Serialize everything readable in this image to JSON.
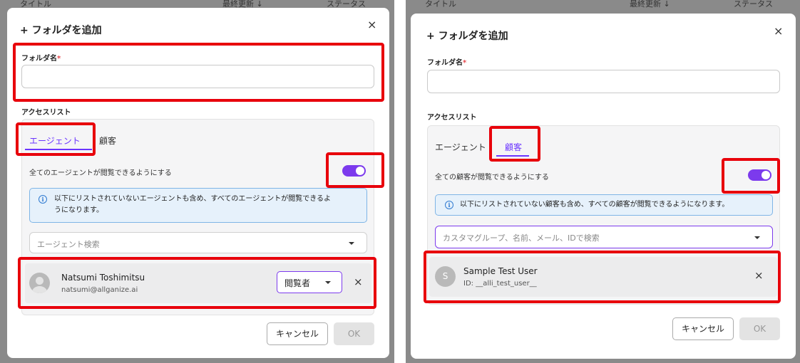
{
  "left": {
    "bg_header": {
      "col_title": "タイトル",
      "col_updated": "最終更新 ↓",
      "col_status": "ステータス"
    },
    "dialog": {
      "title": "+ フォルダを追加",
      "close_icon": "×",
      "folder_label": "フォルダ名",
      "required_mark": "*",
      "folder_value": "",
      "access_list_label": "アクセスリスト",
      "tabs": [
        {
          "label": "エージェント",
          "active": true
        },
        {
          "label": "顧客",
          "active": false
        }
      ],
      "toggle_text": "全てのエージェントが閲覧できるようにする",
      "toggle_on": true,
      "info_icon": "i",
      "info_text_line1": "以下にリストされていないエージェントも含め、すべてのエージェントが閲覧できるよ",
      "info_text_line2": "うになります。",
      "search_placeholder": "エージェント検索",
      "member": {
        "name": "Natsumi Toshimitsu",
        "email": "natsumi@allganize.ai",
        "role": "閲覧者",
        "remove_icon": "×"
      },
      "cancel_label": "キャンセル",
      "ok_label": "OK"
    }
  },
  "right": {
    "bg_header": {
      "col_title": "タイトル",
      "col_updated": "最終更新 ↓",
      "col_status": "ステータス"
    },
    "dialog": {
      "title": "+ フォルダを追加",
      "close_icon": "×",
      "folder_label": "フォルダ名",
      "required_mark": "*",
      "folder_value": "",
      "access_list_label": "アクセスリスト",
      "tabs": [
        {
          "label": "エージェント",
          "active": false
        },
        {
          "label": "顧客",
          "active": true
        }
      ],
      "toggle_text": "全ての顧客が閲覧できるようにする",
      "toggle_on": true,
      "info_icon": "i",
      "info_text_line1": "以下にリストされていない顧客も含め、すべての顧客が閲覧できるようになります。",
      "search_placeholder": "カスタマグループ、名前、メール、IDで検索",
      "member": {
        "avatar_letter": "S",
        "name": "Sample Test User",
        "id_text": "ID: __alli_test_user__",
        "remove_icon": "×"
      },
      "cancel_label": "キャンセル",
      "ok_label": "OK"
    }
  },
  "colors": {
    "accent": "#7c3aed",
    "highlight": "#e8000b",
    "info_bg": "#e6f1fb",
    "info_border": "#7fb5e6",
    "required": "#e5484d"
  }
}
